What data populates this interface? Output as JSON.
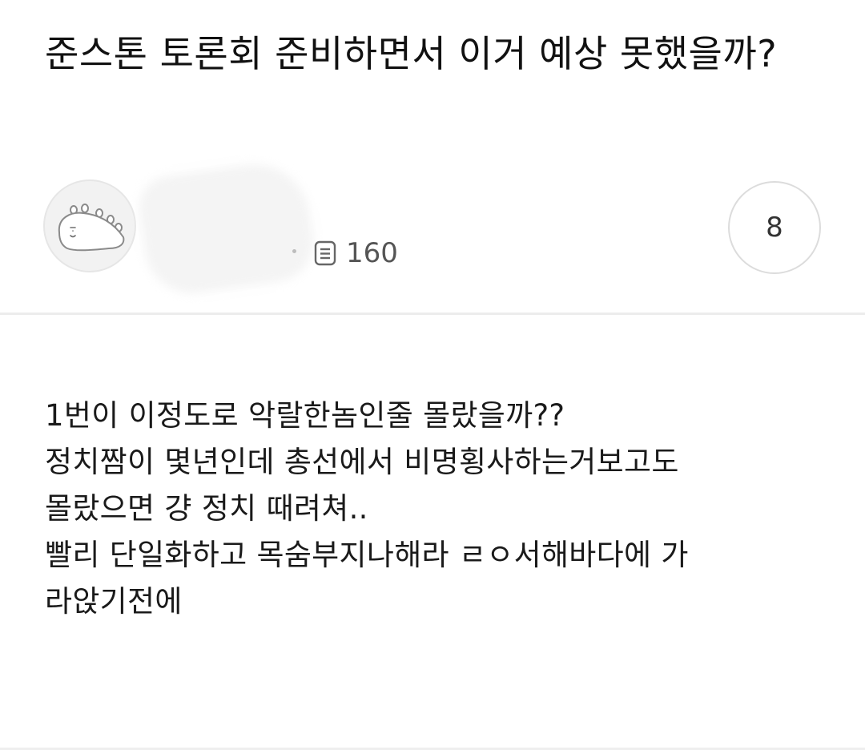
{
  "post": {
    "title": "준스톤 토론회 준비하면서 이거 예상 못했을까?",
    "views": "160",
    "comment_count": "8",
    "body": [
      "1번이 이정도로 악랄한놈인줄 몰랐을까??",
      "정치짬이 몇년인데 총선에서 비명횡사하는거보고도",
      "몰랐으면 걍 정치 때려쳐..",
      "빨리 단일화하고 목숨부지나해라 ㄹㅇ서해바다에 가",
      "라앉기전에"
    ]
  },
  "icons": {
    "avatar": "dinosaur-avatar-icon",
    "views": "document-icon"
  },
  "colors": {
    "text": "#111111",
    "meta": "#555555",
    "border": "#dcdcdc",
    "divider": "#ececec"
  }
}
